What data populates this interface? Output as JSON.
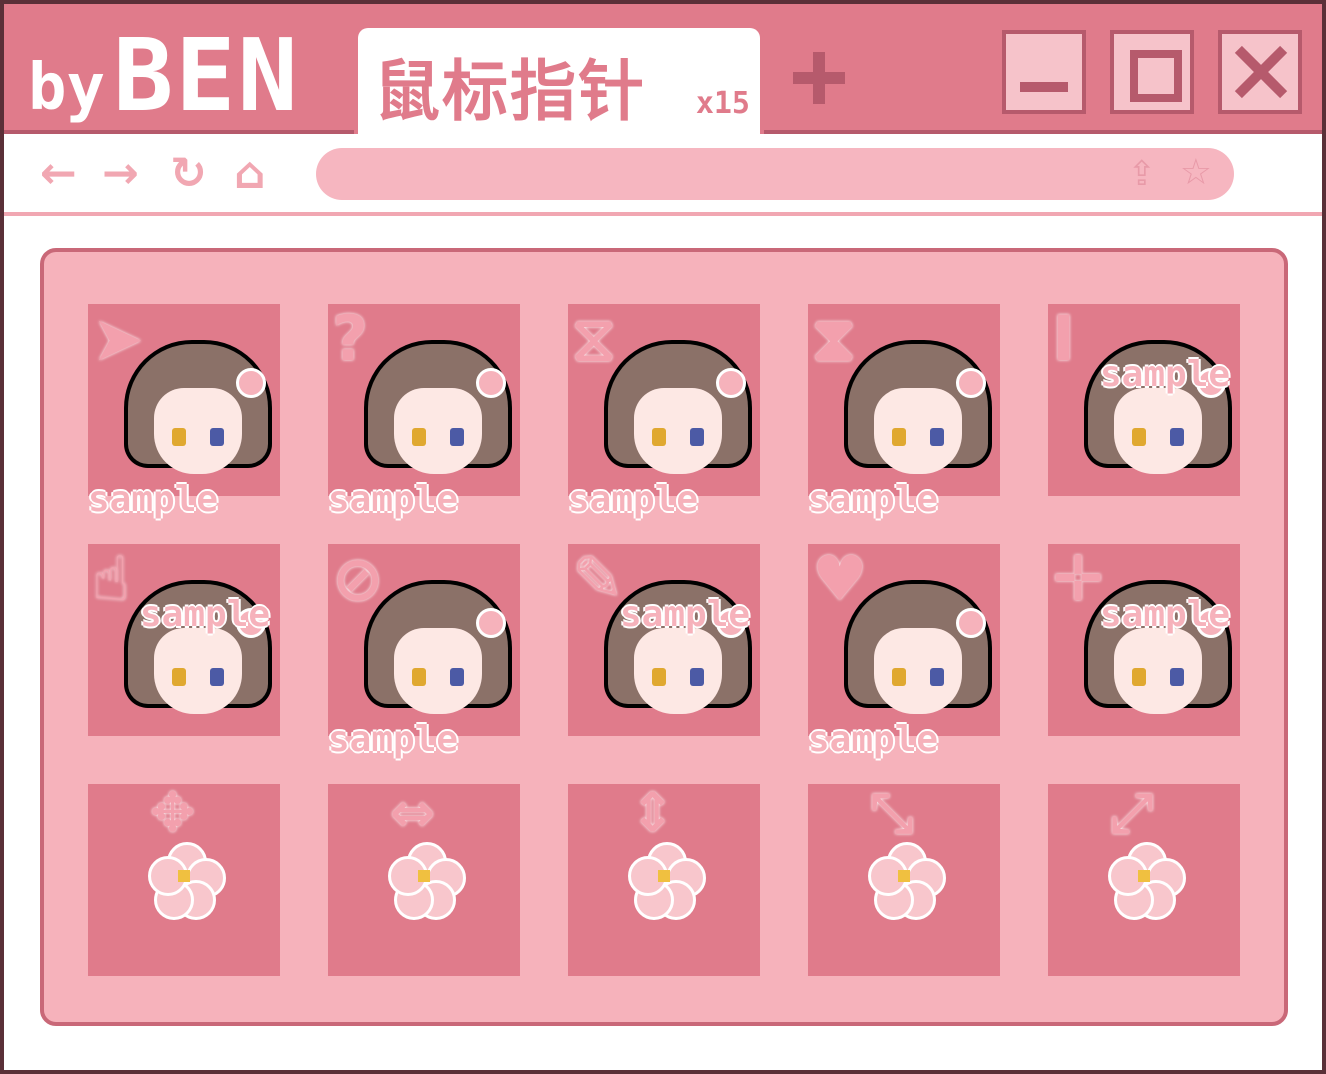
{
  "titlebar": {
    "brand_by": "by",
    "brand_name": "BEN",
    "tab_title": "鼠标指针",
    "tab_count": "x15",
    "new_tab": "+"
  },
  "nav": {
    "back": "←",
    "forward": "→",
    "reload": "↻",
    "home": "⌂",
    "share": "⇪",
    "star": "☆"
  },
  "watermark": "sample",
  "colors": {
    "titlebar": "#e07b8b",
    "accent_dark": "#b65a6c",
    "panel": "#f6b2bb",
    "tile": "#e07b8b"
  },
  "cursors": [
    {
      "name": "normal-select",
      "icon": "pointer-arrow-icon",
      "glyph": "➤"
    },
    {
      "name": "help-select",
      "icon": "help-arrow-icon",
      "glyph": "?"
    },
    {
      "name": "working-in-background",
      "icon": "arrow-busy-icon",
      "glyph": "⧖"
    },
    {
      "name": "busy",
      "icon": "hourglass-icon",
      "glyph": "⧗"
    },
    {
      "name": "text-select",
      "icon": "text-beam-icon",
      "glyph": "I"
    },
    {
      "name": "link-select",
      "icon": "hand-pointer-icon",
      "glyph": "☝"
    },
    {
      "name": "unavailable",
      "icon": "no-sign-icon",
      "glyph": "⊘"
    },
    {
      "name": "handwriting",
      "icon": "pen-icon",
      "glyph": "✎"
    },
    {
      "name": "favorite",
      "icon": "heart-icon",
      "glyph": "♥"
    },
    {
      "name": "precision-select",
      "icon": "crosshair-icon",
      "glyph": "✛"
    },
    {
      "name": "move",
      "icon": "move-arrows-icon",
      "glyph": "✥"
    },
    {
      "name": "horizontal-resize",
      "icon": "horizontal-resize-icon",
      "glyph": "⇔"
    },
    {
      "name": "vertical-resize",
      "icon": "vertical-resize-icon",
      "glyph": "⇕"
    },
    {
      "name": "diagonal-resize-1",
      "icon": "diagonal-resize-nw-icon",
      "glyph": "⤡"
    },
    {
      "name": "diagonal-resize-2",
      "icon": "diagonal-resize-ne-icon",
      "glyph": "⤢"
    }
  ]
}
